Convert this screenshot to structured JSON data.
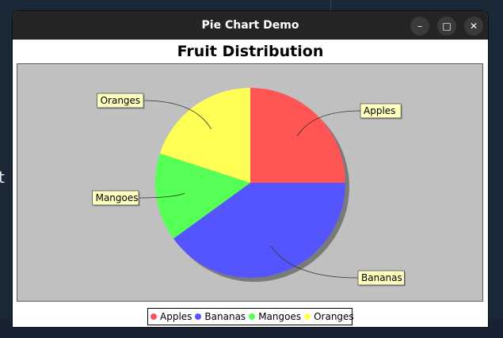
{
  "window": {
    "title": "Pie Chart Demo"
  },
  "controls": {
    "minimize": "–",
    "maximize": "□",
    "close": "✕"
  },
  "desktop": {
    "edge_glyph": "t"
  },
  "chart_data": {
    "type": "pie",
    "title": "Fruit Distribution",
    "categories": [
      "Apples",
      "Bananas",
      "Mangoes",
      "Oranges"
    ],
    "values": [
      25,
      40,
      15,
      20
    ],
    "colors": [
      "#ff5555",
      "#5555ff",
      "#55ff55",
      "#ffff55"
    ],
    "legend_position": "bottom",
    "labels_boxed": true
  },
  "legend": [
    {
      "label": "Apples",
      "color": "#ff5555"
    },
    {
      "label": "Bananas",
      "color": "#5555ff"
    },
    {
      "label": "Mangoes",
      "color": "#55ff55"
    },
    {
      "label": "Oranges",
      "color": "#ffff55"
    }
  ]
}
